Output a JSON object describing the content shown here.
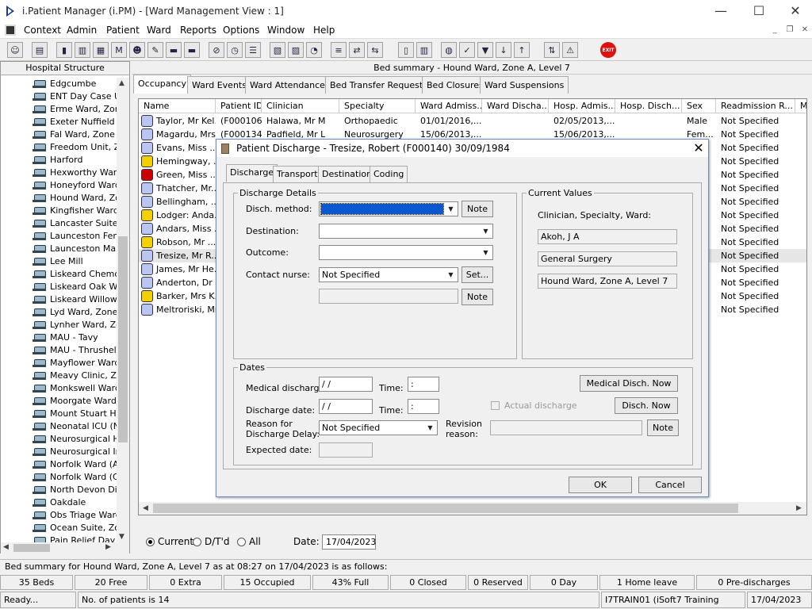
{
  "window": {
    "title": "i.Patient Manager (i.PM) - [Ward Management View : 1]",
    "minimize": "—",
    "maximize": "☐",
    "close": "✕"
  },
  "menu": [
    "Context",
    "Admin",
    "Patient",
    "Ward",
    "Reports",
    "Options",
    "Window",
    "Help"
  ],
  "mdi_controls": [
    "_",
    "❐",
    "✕"
  ],
  "toolbar": {
    "icons": [
      "user-search-icon",
      "print-icon",
      "book-icon",
      "report-icon",
      "card-icon",
      "m-icon",
      "doctor-icon",
      "notes-icon",
      "bed-icon",
      "bed-alt-icon",
      "no-bed-icon",
      "clock-icon",
      "list-icon",
      "chart-icon",
      "form-icon",
      "history-icon",
      "note-icon",
      "transfer-icon",
      "bed-transfer-icon",
      "document-icon",
      "bar-chart-icon",
      "globe-icon",
      "check-list-icon",
      "filter-icon",
      "down-green-icon",
      "up-green-icon",
      "swap-icon",
      "warning-icon"
    ],
    "exit_label": "EXIT"
  },
  "left_panel": {
    "header": "Hospital Structure",
    "items": [
      "Edgcumbe",
      "ENT Day Case U",
      "Erme Ward, Zone",
      "Exeter Nuffield H",
      "Fal Ward, Zone E",
      "Freedom Unit, Zo",
      "Harford",
      "Hexworthy Ward,",
      "Honeyford Ward,",
      "Hound Ward, Zor",
      "Kingfisher Ward",
      "Lancaster Suite, Z",
      "Launceston Fema",
      "Launceston Male",
      "Lee Mill",
      "Liskeard Chemo D",
      "Liskeard Oak Wa",
      "Liskeard Willow V",
      "Lyd Ward, Zone I",
      "Lynher Ward, Zor",
      "MAU - Tavy",
      "MAU - Thrushel",
      "Mayflower Ward,",
      "Meavy Clinic, Zor",
      "Monkswell Ward,",
      "Moorgate Ward, Z",
      "Mount Stuart Hos",
      "Neonatal ICU (NN",
      "Neurosurgical Hig",
      "Neurosurgical Inte",
      "Norfolk Ward (Ad",
      "Norfolk Ward (Co",
      "North Devon Dist",
      "Oakdale",
      "Obs Triage Ward",
      "Ocean Suite, Zor",
      "Pain Relief Day C"
    ]
  },
  "bed_summary_header": "Bed summary - Hound Ward, Zone A, Level 7",
  "tabs": [
    "Occupancy",
    "Ward Events",
    "Ward Attendances",
    "Bed Transfer Requests",
    "Bed Closures",
    "Ward Suspensions"
  ],
  "grid": {
    "columns": [
      "Name",
      "Patient ID",
      "Clinician",
      "Specialty",
      "Ward Admiss...",
      "Ward Discha...",
      "Hosp. Admis...",
      "Hosp. Disch...",
      "Sex",
      "Readmission R...",
      "Me"
    ],
    "rows": [
      {
        "name": "Taylor, Mr Kel...",
        "id": "(F000106)",
        "clinician": "Halawa, Mr M",
        "specialty": "Orthopaedic",
        "ward_adm": "01/01/2016,...",
        "hosp_adm": "02/05/2013,...",
        "sex": "Male",
        "readm": "Not Specified"
      },
      {
        "name": "Magardu, Mrs...",
        "id": "(F000134)",
        "clinician": "Padfield, Mr L",
        "specialty": "Neurosurgery",
        "ward_adm": "15/06/2013,...",
        "hosp_adm": "15/06/2013,...",
        "sex": "Fem...",
        "readm": "Not Specified"
      },
      {
        "name": "Evans, Miss ...",
        "readm": "Not Specified"
      },
      {
        "name": "Hemingway, ...",
        "readm": "Not Specified"
      },
      {
        "name": "Green, Miss ...",
        "readm": "Not Specified"
      },
      {
        "name": "Thatcher, Mr...",
        "readm": "Not Specified"
      },
      {
        "name": "Bellingham, ...",
        "readm": "Not Specified"
      },
      {
        "name": "Lodger: Anda...",
        "readm": "Not Specified"
      },
      {
        "name": "Andars, Miss ...",
        "readm": "Not Specified"
      },
      {
        "name": "Robson, Mr ...",
        "readm": "Not Specified"
      },
      {
        "name": "Tresize, Mr R...",
        "readm": "Not Specified"
      },
      {
        "name": "James, Mr He...",
        "readm": "Not Specified"
      },
      {
        "name": "Anderton, Dr ...",
        "readm": "Not Specified"
      },
      {
        "name": "Barker, Mrs K...",
        "readm": "Not Specified"
      },
      {
        "name": "Meltroriski, Mr...",
        "readm": "Not Specified"
      }
    ]
  },
  "filter": {
    "current": "Current",
    "dtd": "D/T'd",
    "all": "All",
    "date_label": "Date:",
    "date_value": "17/04/2023"
  },
  "status_line": "Bed summary for Hound Ward, Zone A, Level 7 as at 08:27 on 17/04/2023 is as follows:",
  "stats": [
    "35 Beds",
    "20 Free",
    "0 Extra",
    "15 Occupied",
    "43% Full",
    "0 Closed",
    "0 Reserved",
    "0 Day",
    "1 Home leave",
    "0 Pre-discharges"
  ],
  "bottom_bar": {
    "ready": "Ready...",
    "patients": "No. of patients is 14",
    "account": "I7TRAIN01 (iSoft7 Training Account)",
    "date": "17/04/2023"
  },
  "dialog": {
    "title": "Patient Discharge - Tresize, Robert (F000140) 30/09/1984",
    "close": "✕",
    "tabs": [
      "Discharge",
      "Transport",
      "Destination",
      "Coding"
    ],
    "discharge_details": {
      "group_label": "Discharge Details",
      "disch_method_label": "Disch. method:",
      "destination_label": "Destination:",
      "outcome_label": "Outcome:",
      "contact_nurse_label": "Contact nurse:",
      "contact_nurse_value": "Not Specified",
      "note_label": "Note",
      "set_label": "Set..."
    },
    "current_values": {
      "group_label": "Current Values",
      "subtitle": "Clinician, Specialty, Ward:",
      "clinician": "Akoh, J A",
      "specialty": "General Surgery",
      "ward": "Hound Ward, Zone A, Level 7"
    },
    "dates": {
      "group_label": "Dates",
      "medical_discharge_label": "Medical discharge:",
      "medical_discharge_value": " / /",
      "time_label": "Time:",
      "time_value": " :",
      "discharge_date_label": "Discharge date:",
      "discharge_date_value": " / /",
      "reason_label_1": "Reason for",
      "reason_label_2": "Discharge Delay:",
      "reason_value": "Not Specified",
      "revision_label_1": "Revision",
      "revision_label_2": "reason:",
      "expected_label": "Expected date:",
      "medical_now_label": "Medical Disch. Now",
      "disch_now_label": "Disch. Now",
      "actual_discharge_label": "Actual discharge",
      "note_label": "Note"
    },
    "ok_label": "OK",
    "cancel_label": "Cancel"
  }
}
